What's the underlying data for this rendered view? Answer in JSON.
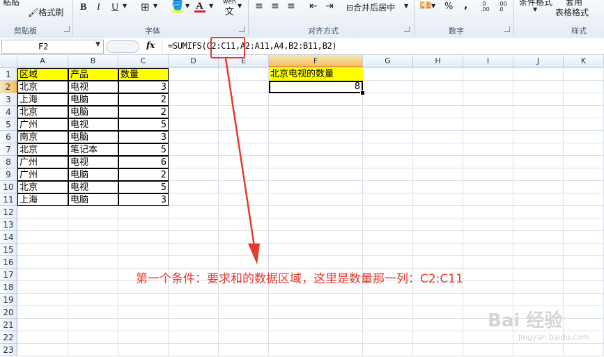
{
  "ribbon": {
    "clipboard": {
      "paste_partial": "粘贴",
      "format_painter": "格式刷",
      "label": "剪贴板"
    },
    "font": {
      "bold": "B",
      "italic": "I",
      "underline": "U",
      "label": "字体",
      "wen": "wén",
      "wen_char": "文"
    },
    "alignment": {
      "merge_center": "合并后居中",
      "label": "对齐方式"
    },
    "number": {
      "percent": "%",
      "comma": ",",
      "inc_decimal": ".0 .00",
      "dec_decimal": ".00 .0",
      "label": "数字"
    },
    "styles": {
      "conditional": "条件格式",
      "apply_partial": "套用",
      "table_format": "表格格式",
      "label": "样式"
    }
  },
  "formula_bar": {
    "name_box": "F2",
    "fx": "fx",
    "formula": "=SUMIFS(C2:C11,A2:A11,A4,B2:B11,B2)"
  },
  "columns": [
    "A",
    "B",
    "C",
    "D",
    "E",
    "F",
    "G",
    "H",
    "I",
    "J",
    "K"
  ],
  "rows": [
    "1",
    "2",
    "3",
    "4",
    "5",
    "6",
    "7",
    "8",
    "9",
    "10",
    "11",
    "12",
    "13",
    "14",
    "15",
    "16",
    "17",
    "18",
    "19",
    "20",
    "21",
    "22",
    "23"
  ],
  "table": {
    "headers": [
      "区域",
      "产品",
      "数量"
    ],
    "rows": [
      [
        "北京",
        "电视",
        "3"
      ],
      [
        "上海",
        "电脑",
        "2"
      ],
      [
        "北京",
        "电脑",
        "2"
      ],
      [
        "广州",
        "电视",
        "5"
      ],
      [
        "南京",
        "电脑",
        "3"
      ],
      [
        "北京",
        "笔记本",
        "5"
      ],
      [
        "广州",
        "电视",
        "6"
      ],
      [
        "广州",
        "电脑",
        "2"
      ],
      [
        "北京",
        "电视",
        "5"
      ],
      [
        "上海",
        "电脑",
        "3"
      ]
    ]
  },
  "result": {
    "label": "北京电视的数量",
    "value": "8"
  },
  "annotation": "第一个条件：要求和的数据区域，这里是数量那一列：C2:C11",
  "watermark": {
    "logo": "Bai 经验",
    "url": "jingyan.baidu.com"
  },
  "colors": {
    "accent_red": "#e53a2d",
    "header_yellow": "#ffff00"
  }
}
